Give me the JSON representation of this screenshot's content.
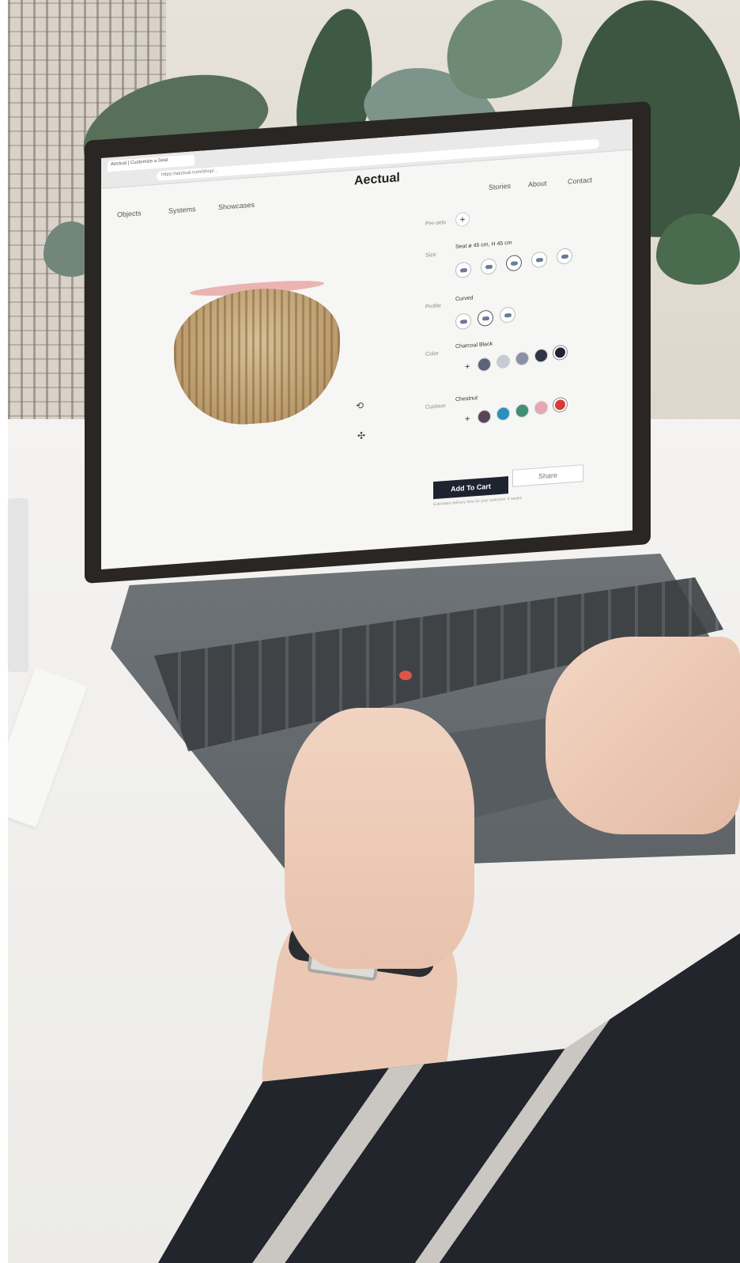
{
  "browser": {
    "tab_title": "Aectual | Customize a Seat",
    "url": "https://aectual.com/shop/..."
  },
  "site": {
    "brand": "Aectual",
    "nav_left": [
      "Objects",
      "Systems",
      "Showcases"
    ],
    "nav_right": [
      "Stories",
      "About",
      "Contact"
    ]
  },
  "configurator": {
    "pre_sets_label": "Pre-sets",
    "size_label": "Size",
    "size_value": "Seat ø 45 cm, H 45 cm",
    "profile_label": "Profile",
    "profile_value": "Curved",
    "color_label": "Color",
    "color_value": "Charcoal Black",
    "color_swatches": [
      "#5c6278",
      "#c9cbd3",
      "#8a90a5",
      "#2f3547",
      "#1e2433"
    ],
    "cushion_label": "Cushion",
    "cushion_value": "Chestnut",
    "cushion_swatches": [
      "#5a4458",
      "#2a8fbf",
      "#3e8f74",
      "#e8a7b3",
      "#d93a37"
    ],
    "add_to_cart": "Add To Cart",
    "share": "Share",
    "delivery_note": "Estimated delivery time for your selection: 6 weeks"
  },
  "colors": {
    "cart_button": "#1d2430",
    "product_tan": "#c7aa7c"
  }
}
